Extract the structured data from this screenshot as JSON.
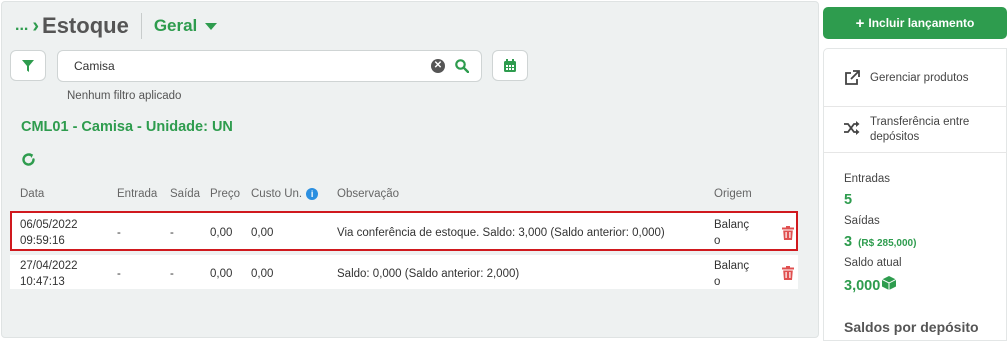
{
  "header": {
    "ellipsis": "...",
    "title": "Estoque",
    "view_label": "Geral"
  },
  "search": {
    "value": "Camisa",
    "filter_note": "Nenhum filtro aplicado"
  },
  "product_title": "CML01 - Camisa - Unidade: UN",
  "table": {
    "columns": {
      "data": "Data",
      "entrada": "Entrada",
      "saida": "Saída",
      "preco": "Preço",
      "custo": "Custo Un.",
      "observacao": "Observação",
      "origem": "Origem"
    },
    "rows": [
      {
        "date": "06/05/2022",
        "time": "09:59:16",
        "entrada": "-",
        "saida": "-",
        "preco": "0,00",
        "custo": "0,00",
        "observacao": "Via conferência de estoque. Saldo: 3,000 (Saldo anterior: 0,000)",
        "origem_1": "Balanç",
        "origem_2": "o"
      },
      {
        "date": "27/04/2022",
        "time": "10:47:13",
        "entrada": "-",
        "saida": "-",
        "preco": "0,00",
        "custo": "0,00",
        "observacao": "Saldo: 0,000 (Saldo anterior: 2,000)",
        "origem_1": "Balanç",
        "origem_2": "o"
      }
    ]
  },
  "sidebar": {
    "add_button": "Incluir lançamento",
    "manage_products": "Gerenciar produtos",
    "transfer_1": "Transferência entre",
    "transfer_2": "depósitos",
    "entradas_label": "Entradas",
    "entradas_value": "5",
    "saidas_label": "Saídas",
    "saidas_value": "3",
    "saidas_amount": "(R$ 285,000)",
    "saldo_label": "Saldo atual",
    "saldo_value": "3,000",
    "saldos_title": "Saldos por depósito"
  },
  "colors": {
    "accent": "#2e9c4e",
    "highlight": "#d0191e",
    "delete": "#e05050",
    "info": "#2b8fe0"
  }
}
